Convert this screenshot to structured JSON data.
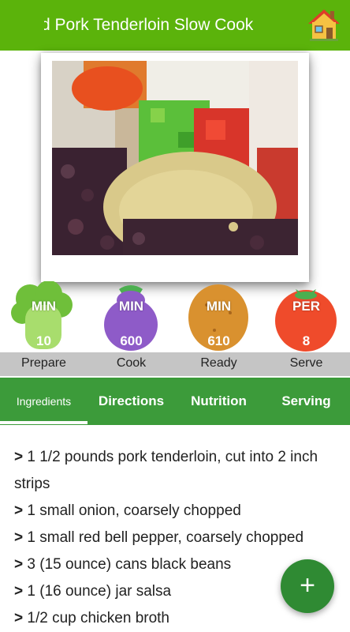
{
  "header": {
    "title": "d Pork Tenderloin Slow Cook",
    "home_icon": "home-icon"
  },
  "stats": [
    {
      "unit": "MIN",
      "value": "10",
      "label": "Prepare",
      "icon": "broccoli-icon",
      "color": "#6fbf3a"
    },
    {
      "unit": "MIN",
      "value": "600",
      "label": "Cook",
      "icon": "eggplant-icon",
      "color": "#8e5bc8"
    },
    {
      "unit": "MIN",
      "value": "610",
      "label": "Ready",
      "icon": "potato-icon",
      "color": "#d9912f"
    },
    {
      "unit": "PER",
      "value": "8",
      "label": "Serve",
      "icon": "tomato-icon",
      "color": "#ef4b2b"
    }
  ],
  "tabs": [
    {
      "label": "Ingredients",
      "active": true
    },
    {
      "label": "Directions",
      "active": false
    },
    {
      "label": "Nutrition",
      "active": false
    },
    {
      "label": "Serving",
      "active": false
    }
  ],
  "ingredients": [
    {
      "marker": ">",
      "text": "1 1/2 pounds pork tenderloin, cut into 2 inch strips"
    },
    {
      "marker": ">",
      "text": "1 small onion, coarsely chopped"
    },
    {
      "marker": ">",
      "text": "1 small red bell pepper, coarsely chopped"
    },
    {
      "marker": ">",
      "text": "3 (15 ounce) cans black beans"
    },
    {
      "marker": ">",
      "text": "1 (16 ounce) jar salsa"
    },
    {
      "marker": ">",
      "text": "1/2 cup chicken broth"
    }
  ],
  "fab": {
    "label": "+",
    "icon": "add-icon"
  },
  "colors": {
    "topbar": "#5bb30b",
    "tabs": "#3c9b3a",
    "fab": "#2f8a33"
  }
}
